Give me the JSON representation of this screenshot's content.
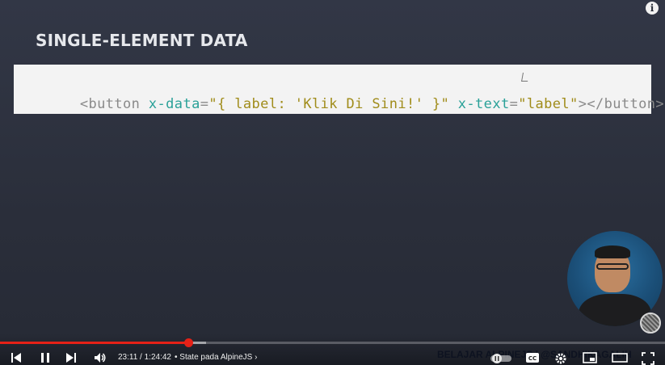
{
  "slide": {
    "title": "SINGLE-ELEMENT DATA",
    "code": [
      {
        "text": "<button ",
        "kind": "tag"
      },
      {
        "text": "x-data",
        "kind": "attr"
      },
      {
        "text": "=",
        "kind": "punct"
      },
      {
        "text": "\"{ label: 'Klik Di Sini!' }\"",
        "kind": "str"
      },
      {
        "text": " ",
        "kind": "punct"
      },
      {
        "text": "x-text",
        "kind": "attr"
      },
      {
        "text": "=",
        "kind": "punct"
      },
      {
        "text": "\"label\"",
        "kind": "str"
      },
      {
        "text": "></button>",
        "kind": "tag"
      }
    ]
  },
  "overlay": {
    "info_icon": "info-icon",
    "info_glyph": "i",
    "channel_banner": "BELAJAR ALPINEJS | @SANDHIKAGALIH"
  },
  "player": {
    "current_time": "23:11",
    "duration": "1:24:42",
    "time_text": "23:11 / 1:24:42",
    "chapter_text": "• State pada AlpineJS",
    "chapter_chevron": "›",
    "progress_fraction": 0.283,
    "buffered_fraction": 0.31,
    "accent_color": "#e62117",
    "icons": [
      "previous-icon",
      "pause-icon",
      "next-icon",
      "volume-icon",
      "autoplay-toggle-icon",
      "captions-icon",
      "settings-icon",
      "miniplayer-icon",
      "theater-icon",
      "fullscreen-icon"
    ]
  }
}
